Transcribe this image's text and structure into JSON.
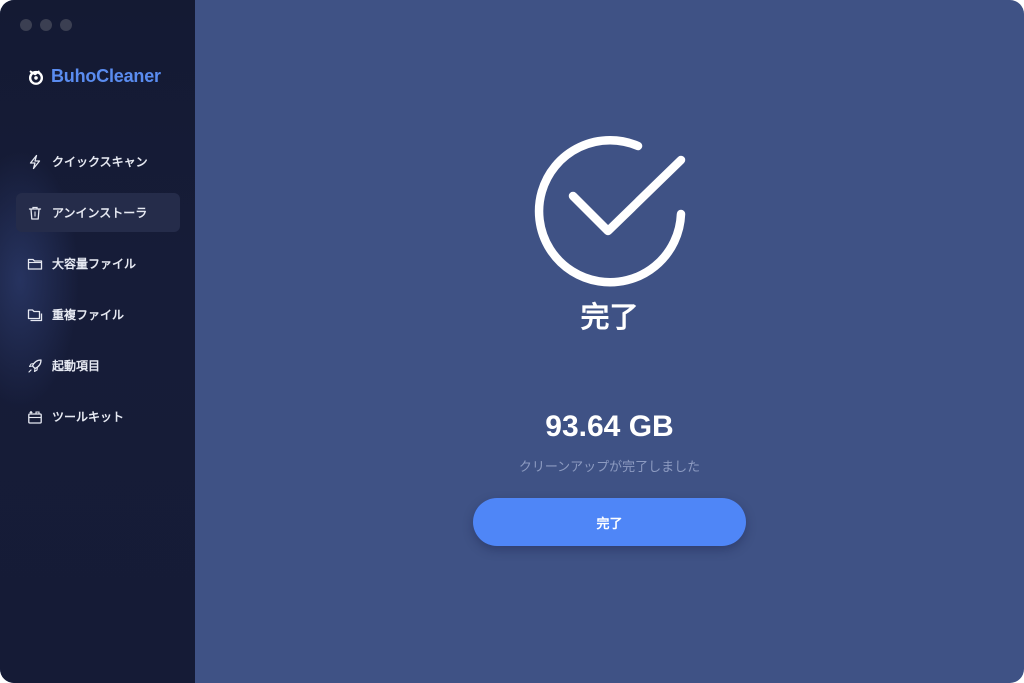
{
  "app": {
    "name": "BuhoCleaner"
  },
  "sidebar": {
    "items": [
      {
        "label": "クイックスキャン",
        "icon": "lightning-icon",
        "active": false
      },
      {
        "label": "アンインストーラ",
        "icon": "trash-icon",
        "active": true
      },
      {
        "label": "大容量ファイル",
        "icon": "folder-icon",
        "active": false
      },
      {
        "label": "重複ファイル",
        "icon": "duplicate-folder-icon",
        "active": false
      },
      {
        "label": "起動項目",
        "icon": "rocket-icon",
        "active": false
      },
      {
        "label": "ツールキット",
        "icon": "toolbox-icon",
        "active": false
      }
    ]
  },
  "main": {
    "status_icon": "check-circle-icon",
    "status_title": "完了",
    "cleaned_size": "93.64 GB",
    "cleaned_caption": "クリーンアップが完了しました",
    "done_button_label": "完了"
  },
  "colors": {
    "sidebar_bg": "#151b36",
    "main_bg": "#3f5285",
    "accent": "#4f86f7",
    "brand": "#5a8cf0"
  }
}
